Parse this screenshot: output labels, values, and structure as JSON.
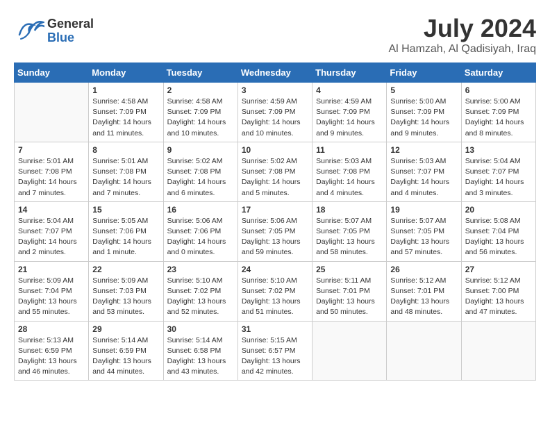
{
  "header": {
    "logo_general": "General",
    "logo_blue": "Blue",
    "month_year": "July 2024",
    "location": "Al Hamzah, Al Qadisiyah, Iraq"
  },
  "days_of_week": [
    "Sunday",
    "Monday",
    "Tuesday",
    "Wednesday",
    "Thursday",
    "Friday",
    "Saturday"
  ],
  "weeks": [
    [
      {
        "day": "",
        "sunrise": "",
        "sunset": "",
        "daylight": ""
      },
      {
        "day": "1",
        "sunrise": "Sunrise: 4:58 AM",
        "sunset": "Sunset: 7:09 PM",
        "daylight": "Daylight: 14 hours and 11 minutes."
      },
      {
        "day": "2",
        "sunrise": "Sunrise: 4:58 AM",
        "sunset": "Sunset: 7:09 PM",
        "daylight": "Daylight: 14 hours and 10 minutes."
      },
      {
        "day": "3",
        "sunrise": "Sunrise: 4:59 AM",
        "sunset": "Sunset: 7:09 PM",
        "daylight": "Daylight: 14 hours and 10 minutes."
      },
      {
        "day": "4",
        "sunrise": "Sunrise: 4:59 AM",
        "sunset": "Sunset: 7:09 PM",
        "daylight": "Daylight: 14 hours and 9 minutes."
      },
      {
        "day": "5",
        "sunrise": "Sunrise: 5:00 AM",
        "sunset": "Sunset: 7:09 PM",
        "daylight": "Daylight: 14 hours and 9 minutes."
      },
      {
        "day": "6",
        "sunrise": "Sunrise: 5:00 AM",
        "sunset": "Sunset: 7:09 PM",
        "daylight": "Daylight: 14 hours and 8 minutes."
      }
    ],
    [
      {
        "day": "7",
        "sunrise": "Sunrise: 5:01 AM",
        "sunset": "Sunset: 7:08 PM",
        "daylight": "Daylight: 14 hours and 7 minutes."
      },
      {
        "day": "8",
        "sunrise": "Sunrise: 5:01 AM",
        "sunset": "Sunset: 7:08 PM",
        "daylight": "Daylight: 14 hours and 7 minutes."
      },
      {
        "day": "9",
        "sunrise": "Sunrise: 5:02 AM",
        "sunset": "Sunset: 7:08 PM",
        "daylight": "Daylight: 14 hours and 6 minutes."
      },
      {
        "day": "10",
        "sunrise": "Sunrise: 5:02 AM",
        "sunset": "Sunset: 7:08 PM",
        "daylight": "Daylight: 14 hours and 5 minutes."
      },
      {
        "day": "11",
        "sunrise": "Sunrise: 5:03 AM",
        "sunset": "Sunset: 7:08 PM",
        "daylight": "Daylight: 14 hours and 4 minutes."
      },
      {
        "day": "12",
        "sunrise": "Sunrise: 5:03 AM",
        "sunset": "Sunset: 7:07 PM",
        "daylight": "Daylight: 14 hours and 4 minutes."
      },
      {
        "day": "13",
        "sunrise": "Sunrise: 5:04 AM",
        "sunset": "Sunset: 7:07 PM",
        "daylight": "Daylight: 14 hours and 3 minutes."
      }
    ],
    [
      {
        "day": "14",
        "sunrise": "Sunrise: 5:04 AM",
        "sunset": "Sunset: 7:07 PM",
        "daylight": "Daylight: 14 hours and 2 minutes."
      },
      {
        "day": "15",
        "sunrise": "Sunrise: 5:05 AM",
        "sunset": "Sunset: 7:06 PM",
        "daylight": "Daylight: 14 hours and 1 minute."
      },
      {
        "day": "16",
        "sunrise": "Sunrise: 5:06 AM",
        "sunset": "Sunset: 7:06 PM",
        "daylight": "Daylight: 14 hours and 0 minutes."
      },
      {
        "day": "17",
        "sunrise": "Sunrise: 5:06 AM",
        "sunset": "Sunset: 7:05 PM",
        "daylight": "Daylight: 13 hours and 59 minutes."
      },
      {
        "day": "18",
        "sunrise": "Sunrise: 5:07 AM",
        "sunset": "Sunset: 7:05 PM",
        "daylight": "Daylight: 13 hours and 58 minutes."
      },
      {
        "day": "19",
        "sunrise": "Sunrise: 5:07 AM",
        "sunset": "Sunset: 7:05 PM",
        "daylight": "Daylight: 13 hours and 57 minutes."
      },
      {
        "day": "20",
        "sunrise": "Sunrise: 5:08 AM",
        "sunset": "Sunset: 7:04 PM",
        "daylight": "Daylight: 13 hours and 56 minutes."
      }
    ],
    [
      {
        "day": "21",
        "sunrise": "Sunrise: 5:09 AM",
        "sunset": "Sunset: 7:04 PM",
        "daylight": "Daylight: 13 hours and 55 minutes."
      },
      {
        "day": "22",
        "sunrise": "Sunrise: 5:09 AM",
        "sunset": "Sunset: 7:03 PM",
        "daylight": "Daylight: 13 hours and 53 minutes."
      },
      {
        "day": "23",
        "sunrise": "Sunrise: 5:10 AM",
        "sunset": "Sunset: 7:02 PM",
        "daylight": "Daylight: 13 hours and 52 minutes."
      },
      {
        "day": "24",
        "sunrise": "Sunrise: 5:10 AM",
        "sunset": "Sunset: 7:02 PM",
        "daylight": "Daylight: 13 hours and 51 minutes."
      },
      {
        "day": "25",
        "sunrise": "Sunrise: 5:11 AM",
        "sunset": "Sunset: 7:01 PM",
        "daylight": "Daylight: 13 hours and 50 minutes."
      },
      {
        "day": "26",
        "sunrise": "Sunrise: 5:12 AM",
        "sunset": "Sunset: 7:01 PM",
        "daylight": "Daylight: 13 hours and 48 minutes."
      },
      {
        "day": "27",
        "sunrise": "Sunrise: 5:12 AM",
        "sunset": "Sunset: 7:00 PM",
        "daylight": "Daylight: 13 hours and 47 minutes."
      }
    ],
    [
      {
        "day": "28",
        "sunrise": "Sunrise: 5:13 AM",
        "sunset": "Sunset: 6:59 PM",
        "daylight": "Daylight: 13 hours and 46 minutes."
      },
      {
        "day": "29",
        "sunrise": "Sunrise: 5:14 AM",
        "sunset": "Sunset: 6:59 PM",
        "daylight": "Daylight: 13 hours and 44 minutes."
      },
      {
        "day": "30",
        "sunrise": "Sunrise: 5:14 AM",
        "sunset": "Sunset: 6:58 PM",
        "daylight": "Daylight: 13 hours and 43 minutes."
      },
      {
        "day": "31",
        "sunrise": "Sunrise: 5:15 AM",
        "sunset": "Sunset: 6:57 PM",
        "daylight": "Daylight: 13 hours and 42 minutes."
      },
      {
        "day": "",
        "sunrise": "",
        "sunset": "",
        "daylight": ""
      },
      {
        "day": "",
        "sunrise": "",
        "sunset": "",
        "daylight": ""
      },
      {
        "day": "",
        "sunrise": "",
        "sunset": "",
        "daylight": ""
      }
    ]
  ]
}
